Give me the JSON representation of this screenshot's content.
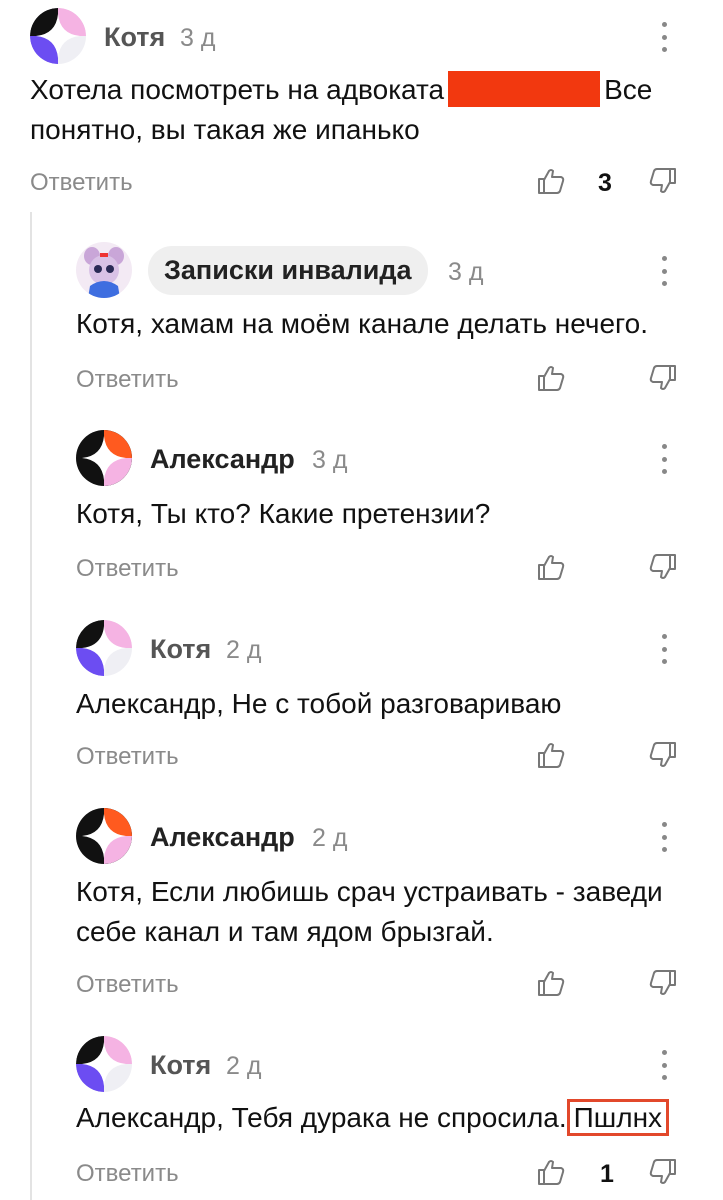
{
  "comments": [
    {
      "author": "Котя",
      "time": "3 д",
      "text": "Хотела посмотреть на адвоката",
      "text2": "Все",
      "text3": "понятно, вы такая же ипанько",
      "reply": "Ответить",
      "likes": "3"
    },
    {
      "author": "Записки инвалида",
      "time": "3 д",
      "text": "Котя, хамам на моём канале делать нечего.",
      "reply": "Ответить",
      "likes": ""
    },
    {
      "author": "Александр",
      "time": "3 д",
      "text": "Котя, Ты кто? Какие претензии?",
      "reply": "Ответить",
      "likes": ""
    },
    {
      "author": "Котя",
      "time": "2 д",
      "text": "Александр, Не с тобой разговариваю",
      "reply": "Ответить",
      "likes": ""
    },
    {
      "author": "Александр",
      "time": "2 д",
      "text": "Котя, Если любишь срач устраивать - заведи",
      "text2": "себе канал и там ядом брызгай.",
      "reply": "Ответить",
      "likes": ""
    },
    {
      "author": "Котя",
      "time": "2 д",
      "text": "Александр, Тебя дурака не спросила.",
      "text2": "Пшлнх",
      "reply": "Ответить",
      "likes": "1"
    }
  ],
  "icons": {
    "like": "thumbs-up-icon",
    "dislike": "thumbs-down-icon",
    "more": "more-vertical-icon"
  },
  "colors": {
    "redaction": "#f2380f",
    "highlight_box": "#e2482b",
    "avatar_purple": "#6c4df2",
    "avatar_pink": "#f5b3e3",
    "avatar_orange": "#ff5a1f"
  }
}
